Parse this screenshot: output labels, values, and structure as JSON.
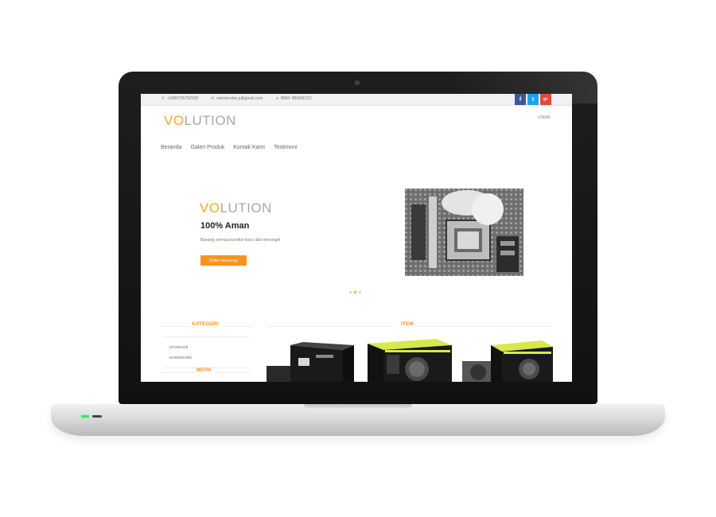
{
  "topbar": {
    "phone": "+6285755792000",
    "email": "sabrian.den.p@gmail.com",
    "bbm": "BBM: 5B566DCC",
    "social": [
      "f",
      "t",
      "g+"
    ]
  },
  "header": {
    "logo_accent": "VO",
    "logo_rest": "LUTION",
    "login": "LOGIN"
  },
  "nav": {
    "items": [
      "Beranda",
      "Galeri Produk",
      "Kontak Kami",
      "Testimoni"
    ]
  },
  "hero": {
    "logo_accent": "VO",
    "logo_rest": "LUTION",
    "title": "100% Aman",
    "subtitle": "Barang semua kondisi baru dan bersegel",
    "button": "Order sekarang!"
  },
  "sidebar": {
    "kategori_title": "KATEGORI",
    "categories": [
      "STORAGE",
      "HARDWARE"
    ],
    "merk_title": "MERK"
  },
  "main": {
    "item_title": "ITEM"
  },
  "colors": {
    "accent": "#f7941d",
    "facebook": "#3b5998",
    "twitter": "#1da1f2",
    "google": "#dd4b39"
  }
}
